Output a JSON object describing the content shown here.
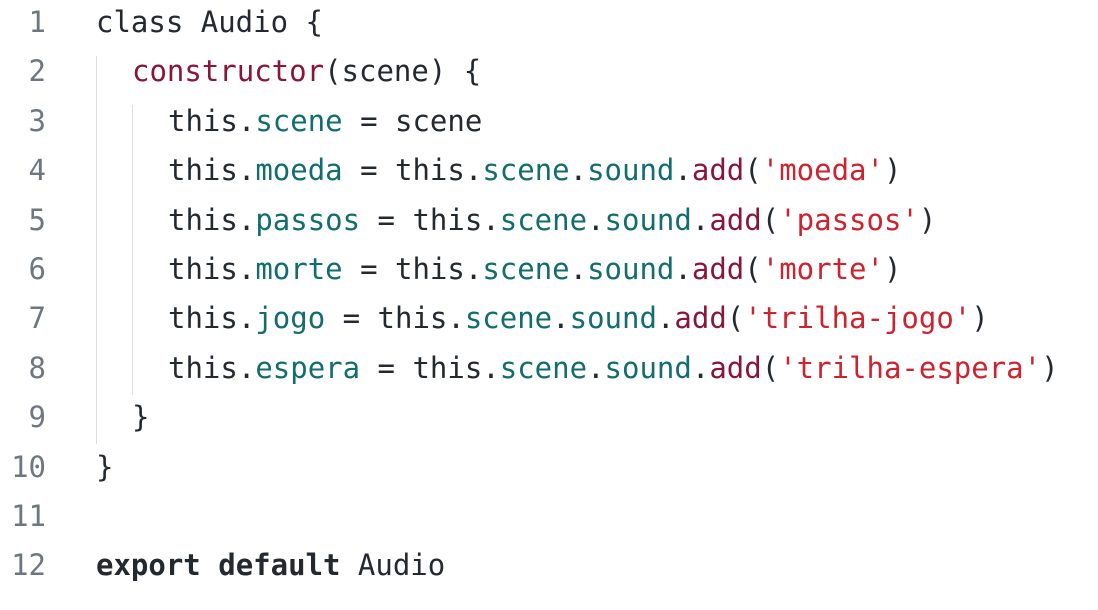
{
  "code": {
    "lines": [
      {
        "n": "1",
        "tokens": [
          {
            "t": "class Audio {",
            "c": "plain"
          }
        ],
        "indent": 0
      },
      {
        "n": "2",
        "tokens": [
          {
            "t": "constructor",
            "c": "ctor"
          },
          {
            "t": "(scene) {",
            "c": "plain"
          }
        ],
        "indent": 1
      },
      {
        "n": "3",
        "tokens": [
          {
            "t": "this.",
            "c": "plain"
          },
          {
            "t": "scene",
            "c": "prop"
          },
          {
            "t": " = scene",
            "c": "plain"
          }
        ],
        "indent": 2
      },
      {
        "n": "4",
        "tokens": [
          {
            "t": "this.",
            "c": "plain"
          },
          {
            "t": "moeda",
            "c": "prop"
          },
          {
            "t": " = this.",
            "c": "plain"
          },
          {
            "t": "scene",
            "c": "prop"
          },
          {
            "t": ".",
            "c": "plain"
          },
          {
            "t": "sound",
            "c": "prop"
          },
          {
            "t": ".",
            "c": "plain"
          },
          {
            "t": "add",
            "c": "meth"
          },
          {
            "t": "(",
            "c": "plain"
          },
          {
            "t": "'moeda'",
            "c": "str"
          },
          {
            "t": ")",
            "c": "plain"
          }
        ],
        "indent": 2
      },
      {
        "n": "5",
        "tokens": [
          {
            "t": "this.",
            "c": "plain"
          },
          {
            "t": "passos",
            "c": "prop"
          },
          {
            "t": " = this.",
            "c": "plain"
          },
          {
            "t": "scene",
            "c": "prop"
          },
          {
            "t": ".",
            "c": "plain"
          },
          {
            "t": "sound",
            "c": "prop"
          },
          {
            "t": ".",
            "c": "plain"
          },
          {
            "t": "add",
            "c": "meth"
          },
          {
            "t": "(",
            "c": "plain"
          },
          {
            "t": "'passos'",
            "c": "str"
          },
          {
            "t": ")",
            "c": "plain"
          }
        ],
        "indent": 2
      },
      {
        "n": "6",
        "tokens": [
          {
            "t": "this.",
            "c": "plain"
          },
          {
            "t": "morte",
            "c": "prop"
          },
          {
            "t": " = this.",
            "c": "plain"
          },
          {
            "t": "scene",
            "c": "prop"
          },
          {
            "t": ".",
            "c": "plain"
          },
          {
            "t": "sound",
            "c": "prop"
          },
          {
            "t": ".",
            "c": "plain"
          },
          {
            "t": "add",
            "c": "meth"
          },
          {
            "t": "(",
            "c": "plain"
          },
          {
            "t": "'morte'",
            "c": "str"
          },
          {
            "t": ")",
            "c": "plain"
          }
        ],
        "indent": 2
      },
      {
        "n": "7",
        "tokens": [
          {
            "t": "this.",
            "c": "plain"
          },
          {
            "t": "jogo",
            "c": "prop"
          },
          {
            "t": " = this.",
            "c": "plain"
          },
          {
            "t": "scene",
            "c": "prop"
          },
          {
            "t": ".",
            "c": "plain"
          },
          {
            "t": "sound",
            "c": "prop"
          },
          {
            "t": ".",
            "c": "plain"
          },
          {
            "t": "add",
            "c": "meth"
          },
          {
            "t": "(",
            "c": "plain"
          },
          {
            "t": "'trilha-jogo'",
            "c": "str"
          },
          {
            "t": ")",
            "c": "plain"
          }
        ],
        "indent": 2
      },
      {
        "n": "8",
        "tokens": [
          {
            "t": "this.",
            "c": "plain"
          },
          {
            "t": "espera",
            "c": "prop"
          },
          {
            "t": " = this.",
            "c": "plain"
          },
          {
            "t": "scene",
            "c": "prop"
          },
          {
            "t": ".",
            "c": "plain"
          },
          {
            "t": "sound",
            "c": "prop"
          },
          {
            "t": ".",
            "c": "plain"
          },
          {
            "t": "add",
            "c": "meth"
          },
          {
            "t": "(",
            "c": "plain"
          },
          {
            "t": "'trilha-espera'",
            "c": "str"
          },
          {
            "t": ")",
            "c": "plain"
          }
        ],
        "indent": 2
      },
      {
        "n": "9",
        "tokens": [
          {
            "t": "}",
            "c": "plain"
          }
        ],
        "indent": 1
      },
      {
        "n": "10",
        "tokens": [
          {
            "t": "}",
            "c": "plain"
          }
        ],
        "indent": 0
      },
      {
        "n": "11",
        "tokens": [],
        "indent": 0
      },
      {
        "n": "12",
        "tokens": [
          {
            "t": "export",
            "c": "kw"
          },
          {
            "t": " ",
            "c": "plain"
          },
          {
            "t": "default",
            "c": "kw"
          },
          {
            "t": " Audio",
            "c": "plain"
          }
        ],
        "indent": 0
      }
    ]
  },
  "colors": {
    "background": "#ffffff",
    "line_number": "#6e7781",
    "text": "#24292f",
    "property": "#116d6e",
    "method": "#8a1538",
    "string": "#cf222e",
    "indent_guide": "#d8dee4"
  }
}
